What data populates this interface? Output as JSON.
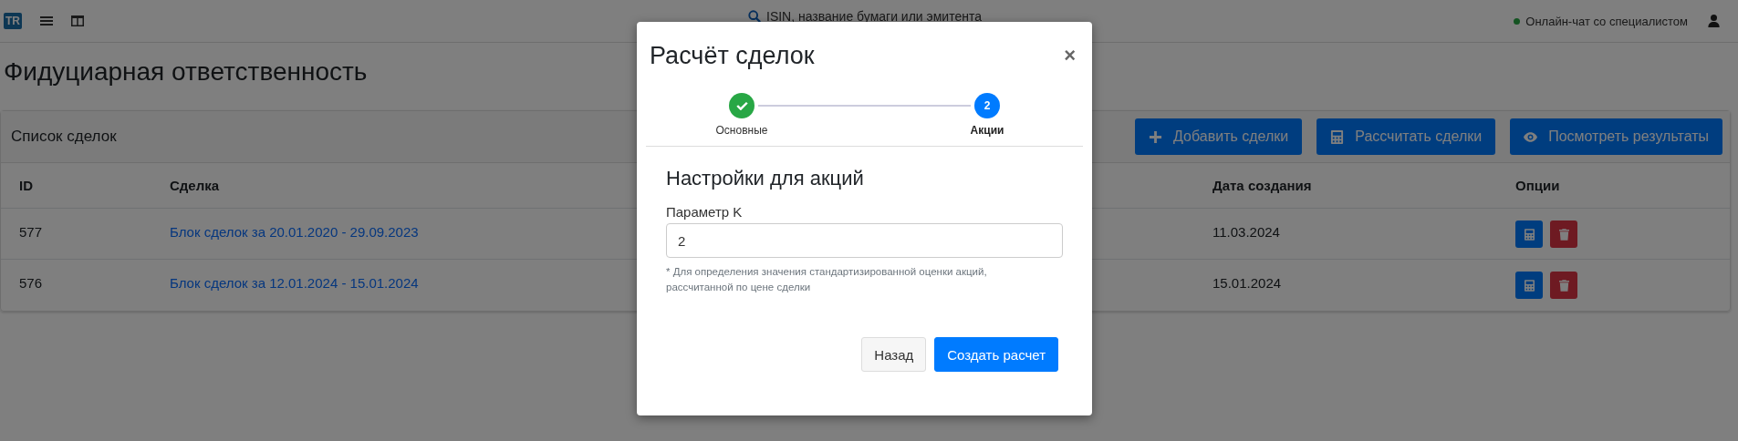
{
  "topbar": {
    "logo": "TR",
    "search": {
      "placeholder": "ISIN, название бумаги или эмитента"
    },
    "chat_link": "Онлайн-чат со специалистом"
  },
  "page_title": "Фидуциарная ответственность",
  "card": {
    "title": "Список сделок",
    "buttons": [
      {
        "label": "Добавить сделки",
        "kind": "add"
      },
      {
        "label": "Рассчитать сделки",
        "kind": "calc"
      },
      {
        "label": "Посмотреть результаты",
        "kind": "view"
      }
    ]
  },
  "table": {
    "columns": [
      {
        "label": "ID",
        "kind": "id"
      },
      {
        "label": "Сделка",
        "kind": "deal"
      },
      {
        "label": "Дата создания",
        "kind": "date"
      },
      {
        "label": "Опции",
        "kind": "options"
      }
    ],
    "rows": [
      {
        "id": "577",
        "deal": "Блок сделок за 20.01.2020 - 29.09.2023",
        "date": "11.03.2024"
      },
      {
        "id": "576",
        "deal": "Блок сделок за 12.01.2024 - 15.01.2024",
        "date": "15.01.2024"
      }
    ]
  },
  "modal": {
    "title": "Расчёт сделок",
    "close": "×",
    "steps": [
      {
        "label": "Основные",
        "completed": true,
        "current": false
      },
      {
        "label": "Акции",
        "completed": false,
        "current": true,
        "number": "2"
      }
    ],
    "section_title": "Настройки для акций",
    "field": {
      "label": "Параметр K",
      "value": "2",
      "hint": "* Для определения значения стандартизированной оценки акций, рассчитанной по цене сделки"
    },
    "buttons": [
      {
        "label": "Назад",
        "kind": "secondary"
      },
      {
        "label": "Создать расчет",
        "kind": "primary"
      }
    ]
  }
}
